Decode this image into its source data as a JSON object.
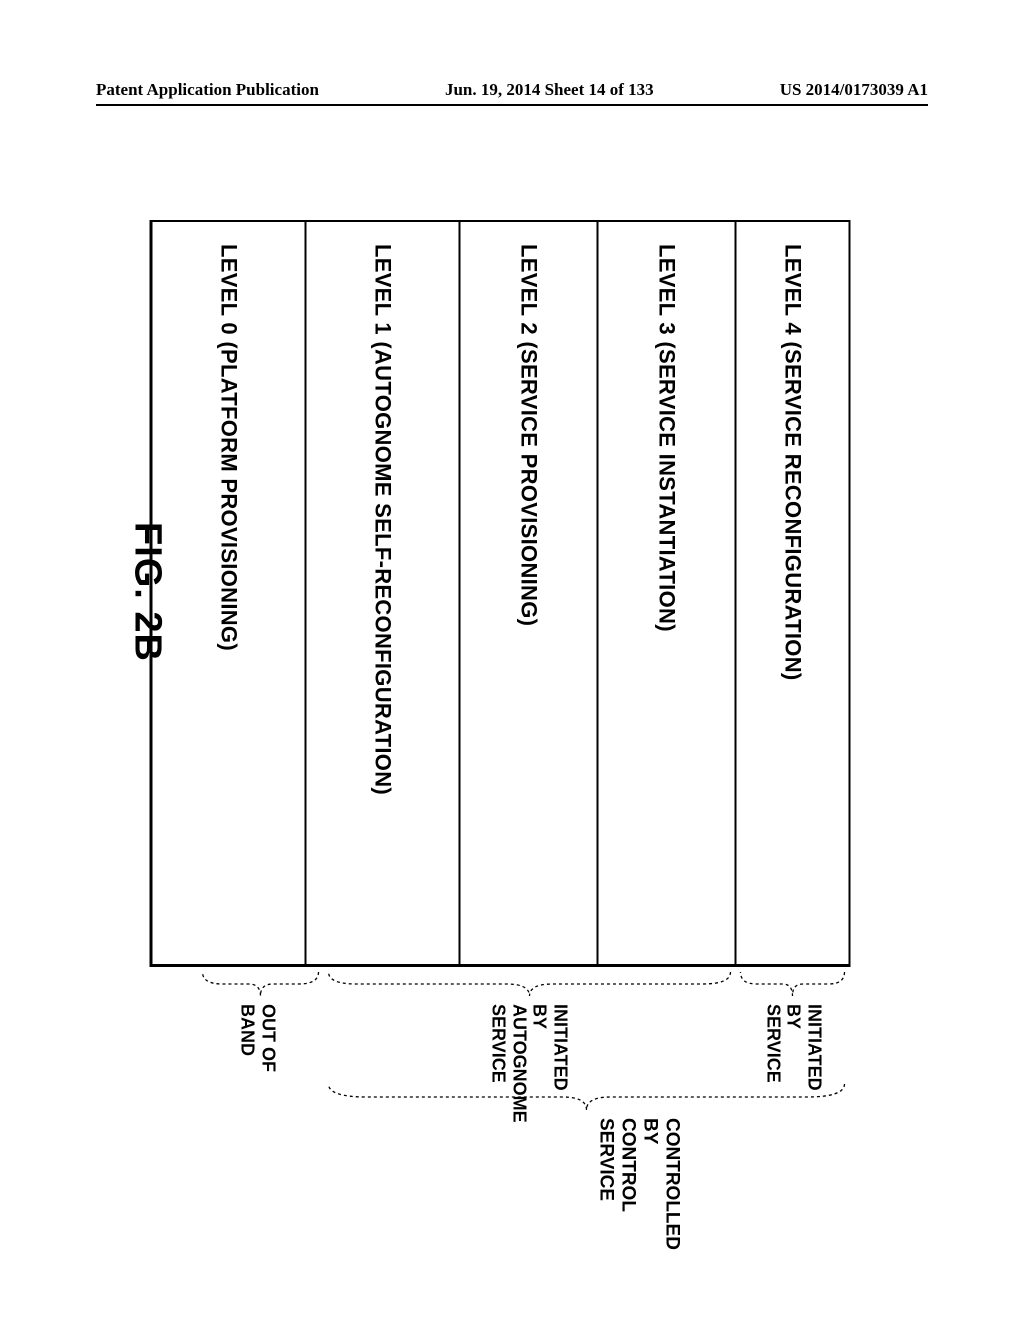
{
  "header": {
    "left": "Patent Application Publication",
    "center": "Jun. 19, 2014  Sheet 14 of 133",
    "right": "US 2014/0173039 A1"
  },
  "levels": {
    "l4": "LEVEL 4 (SERVICE RECONFIGURATION)",
    "l3": "LEVEL 3 (SERVICE INSTANTIATION)",
    "l2": "LEVEL 2 (SERVICE PROVISIONING)",
    "l1": "LEVEL 1 (AUTOGNOME SELF-RECONFIGURATION)",
    "l0": "LEVEL 0 (PLATFORM PROVISIONING)"
  },
  "brackets": {
    "inner_top": "INITIATED\nBY\nSERVICE",
    "inner_mid": "INITIATED\nBY\nAUTOGNOME\nSERVICE",
    "inner_bot": "OUT OF\nBAND",
    "outer": "CONTROLLED BY\nCONTROL SERVICE"
  },
  "caption": "FIG. 2B"
}
